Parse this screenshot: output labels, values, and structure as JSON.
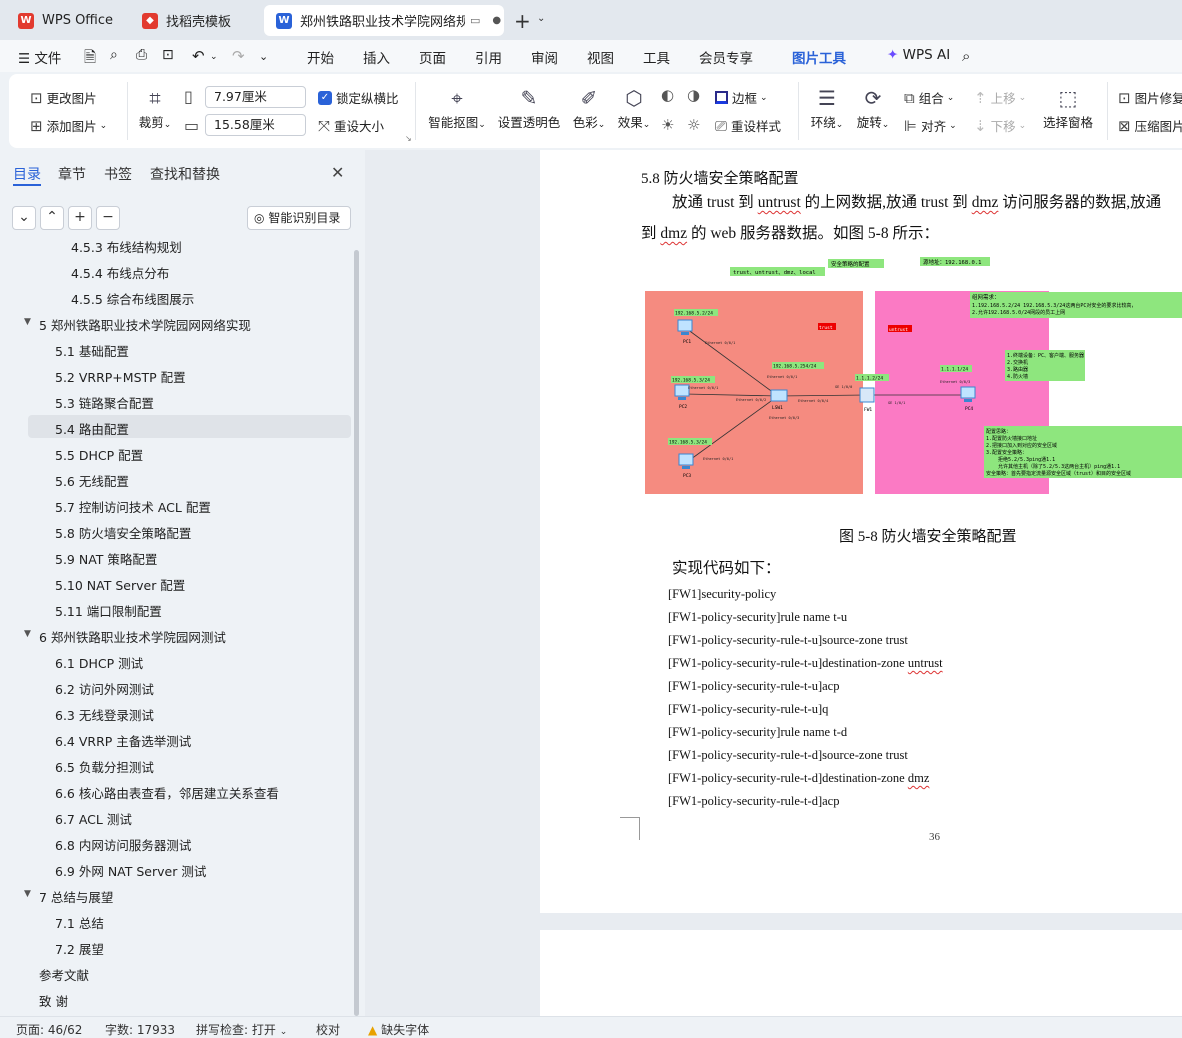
{
  "tabs": [
    {
      "label": "WPS Office",
      "icon": "wps-logo-icon",
      "color": "#e23a2f"
    },
    {
      "label": "找稻壳模板",
      "icon": "docer-icon",
      "color": "#e23a2f"
    },
    {
      "label": "郑州铁路职业技术学院网络规划",
      "icon": "word-doc-icon",
      "color": "#2a62d8"
    }
  ],
  "menu": {
    "file": "文件",
    "items": [
      "开始",
      "插入",
      "页面",
      "引用",
      "审阅",
      "视图",
      "工具",
      "会员专享",
      "图片工具"
    ],
    "active": "图片工具",
    "ai": "WPS AI"
  },
  "ribbon": {
    "change_image": "更改图片",
    "add_image": "添加图片",
    "crop": "裁剪",
    "width_value": "7.97厘米",
    "height_value": "15.58厘米",
    "lock_ratio": "锁定纵横比",
    "reset_size": "重设大小",
    "smart_cutout": "智能抠图",
    "set_transparent": "设置透明色",
    "color": "色彩",
    "effect": "效果",
    "border": "边框",
    "reset_style": "重设样式",
    "wrap": "环绕",
    "rotate": "旋转",
    "group": "组合",
    "align": "对齐",
    "move_up": "上移",
    "move_down": "下移",
    "selection_pane": "选择窗格",
    "image_repair": "图片修复",
    "compress": "压缩图片"
  },
  "sidebar": {
    "tabs": [
      "目录",
      "章节",
      "书签",
      "查找和替换"
    ],
    "active_tab": "目录",
    "smart_toc": "智能识别目录",
    "toc": [
      {
        "text": "4.5.3  布线结构规划",
        "level": 3
      },
      {
        "text": "4.5.4  布线点分布",
        "level": 3
      },
      {
        "text": "4.5.5  综合布线图展示",
        "level": 3
      },
      {
        "text": "5  郑州铁路职业技术学院园网网络实现",
        "level": 1
      },
      {
        "text": "5.1 基础配置",
        "level": 2
      },
      {
        "text": "5.2 VRRP+MSTP 配置",
        "level": 2
      },
      {
        "text": "5.3 链路聚合配置",
        "level": 2
      },
      {
        "text": "5.4 路由配置",
        "level": 2,
        "selected": true
      },
      {
        "text": "5.5 DHCP 配置",
        "level": 2
      },
      {
        "text": "5.6 无线配置",
        "level": 2
      },
      {
        "text": "5.7 控制访问技术 ACL 配置",
        "level": 2
      },
      {
        "text": "5.8 防火墙安全策略配置",
        "level": 2
      },
      {
        "text": "5.9 NAT 策略配置",
        "level": 2
      },
      {
        "text": "5.10 NAT Server 配置",
        "level": 2
      },
      {
        "text": "5.11 端口限制配置",
        "level": 2
      },
      {
        "text": "6  郑州铁路职业技术学院园网测试",
        "level": 1
      },
      {
        "text": "6.1 DHCP 测试",
        "level": 2
      },
      {
        "text": "6.2 访问外网测试",
        "level": 2
      },
      {
        "text": "6.3 无线登录测试",
        "level": 2
      },
      {
        "text": "6.4 VRRP 主备选举测试",
        "level": 2
      },
      {
        "text": "6.5 负载分担测试",
        "level": 2
      },
      {
        "text": "6.6 核心路由表查看，邻居建立关系查看",
        "level": 2
      },
      {
        "text": "6.7 ACL 测试",
        "level": 2
      },
      {
        "text": "6.8 内网访问服务器测试",
        "level": 2
      },
      {
        "text": "6.9 外网 NAT Server 测试",
        "level": 2
      },
      {
        "text": "7  总结与展望",
        "level": 1
      },
      {
        "text": "7.1  总结",
        "level": 2
      },
      {
        "text": "7.2  展望",
        "level": 2
      },
      {
        "text": "参考文献",
        "level": 0
      },
      {
        "text": "致    谢",
        "level": 0
      }
    ]
  },
  "doc": {
    "heading": "5.8 防火墙安全策略配置",
    "para1_a": "放通 trust 到",
    "para1_b": "untrust",
    "para1_c": "的上网数据,放通 trust 到",
    "para1_d": "dmz",
    "para1_e": "访问服务器的数据,放通",
    "para2_a": "到",
    "para2_b": "dmz",
    "para2_c": "的 web 服务器数据。如图 5-8 所示：",
    "caption": "图 5-8  防火墙安全策略配置",
    "code_intro": "实现代码如下：",
    "code": [
      "[FW1]security-policy",
      "[FW1-policy-security]rule name t-u",
      "[FW1-policy-security-rule-t-u]source-zone trust",
      "[FW1-policy-security-rule-t-u]destination-zone untrust",
      "[FW1-policy-security-rule-t-u]acp",
      "[FW1-policy-security-rule-t-u]q",
      "[FW1-policy-security]rule name t-d",
      "[FW1-policy-security-rule-t-d]source-zone trust",
      "[FW1-policy-security-rule-t-d]destination-zone dmz",
      "[FW1-policy-security-rule-t-d]acp"
    ],
    "page_number": "36"
  },
  "diagram": {
    "label_zones": "trust、untrust、dmz、local",
    "label_policy": "安全策略的配置",
    "label_source": "源地址：192.168.0.1",
    "trust_tag": "trust",
    "untrust_tag": "untrust",
    "pc1_ip": "192.168.5.2/24",
    "pc2_ip": "192.168.5.3/24",
    "pc3_ip": "192.168.5.3/24",
    "lsw_ip": "192.168.5.254/24",
    "fw_ip": "1.1.1.2/24",
    "pc4_ip": "1.1.1.1/24",
    "pc1": "PC1",
    "pc2": "PC2",
    "pc3": "PC3",
    "pc4": "PC4",
    "lsw": "LSW1",
    "fw": "FW1",
    "req_title": "组网需求：",
    "req_1": "1.192.168.5.2/24 192.168.5.3/24这两台PC对安全的要求比较高，",
    "req_2": "2.允许192.168.5.0/24网段的员工上网",
    "dev_1": "1.终端设备：PC、客户端、服务器",
    "dev_2": "2.交换机",
    "dev_3": "3.路由器",
    "dev_4": "4.防火墙",
    "cfg_title": "配置思路：",
    "cfg_1": "1.配置防火墙接口地址",
    "cfg_2": "2.把接口加入到对应的安全区域",
    "cfg_3": "3.配置安全策略：",
    "cfg_4": "拒绝5.2/5.3ping通1.1",
    "cfg_5": "允许其他主机（除了5.2/5.3这两台主机）ping通1.1",
    "cfg_6": "安全策略：首先要指定流量源安全区域（trust）和目的安全区域",
    "eth_labels": [
      "Ethernet 0/0/1",
      "Ethernet 0/0/1",
      "Ethernet 0/0/2",
      "Ethernet 0/0/1",
      "Ethernet 0/0/3",
      "Ethernet 0/0/4",
      "GE 1/0/0",
      "GE 1/0/1",
      "Ethernet 0/0/1",
      "Ethernet 0/0/3"
    ]
  },
  "status": {
    "page": "页面: 46/62",
    "words": "字数: 17933",
    "spell": "拼写检查: 打开",
    "proof": "校对",
    "missing_font": "缺失字体"
  },
  "colors": {
    "accent": "#2a62d8",
    "trust_zone": "#f58b80",
    "untrust_zone": "#fb7ac4",
    "note_green": "#8ee67e",
    "selected_row": "#dfe3e8"
  }
}
